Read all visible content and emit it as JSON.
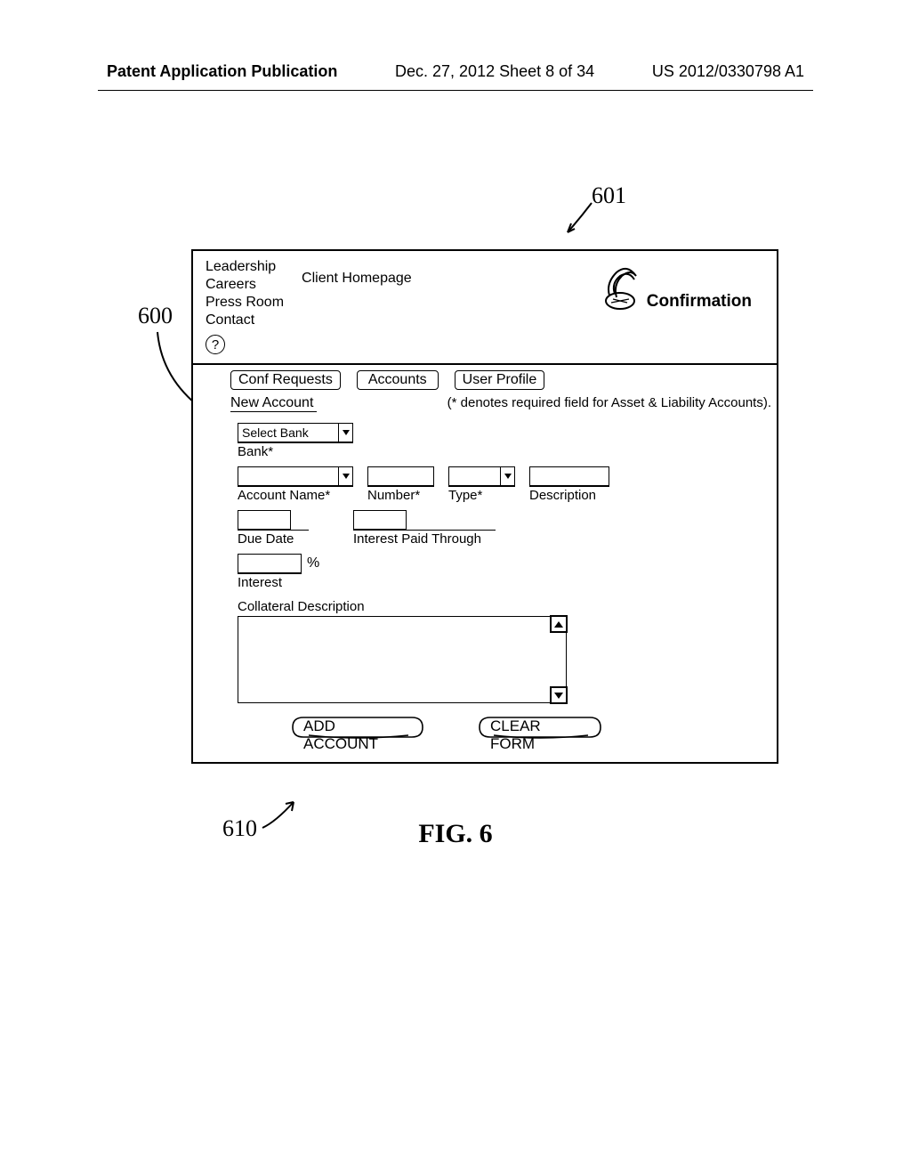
{
  "page_header": {
    "left": "Patent Application Publication",
    "center": "Dec. 27, 2012  Sheet 8 of 34",
    "right": "US 2012/0330798 A1"
  },
  "callouts": {
    "c601": "601",
    "c600": "600",
    "c610": "610"
  },
  "nav": {
    "items": [
      "Leadership",
      "Careers",
      "Press Room",
      "Contact"
    ],
    "client_homepage": "Client Homepage"
  },
  "brand": {
    "name": "Confirmation"
  },
  "help_icon": "?",
  "tabs": {
    "t0": "Conf Requests",
    "t1": "Accounts",
    "t2": "User Profile"
  },
  "form": {
    "title": "New Account",
    "note": "(* denotes required field for Asset & Liability Accounts).",
    "select_bank_value": "Select Bank",
    "bank_label": "Bank*",
    "account_name_label": "Account Name*",
    "number_label": "Number*",
    "type_label": "Type*",
    "description_label": "Description",
    "due_date_label": "Due Date",
    "interest_paid_label": "Interest Paid Through",
    "pct_label": "%",
    "interest_label": "Interest",
    "collateral_label": "Collateral Description",
    "add_account_btn": "ADD ACCOUNT",
    "clear_form_btn": "CLEAR FORM"
  },
  "figure_caption": "FIG. 6"
}
